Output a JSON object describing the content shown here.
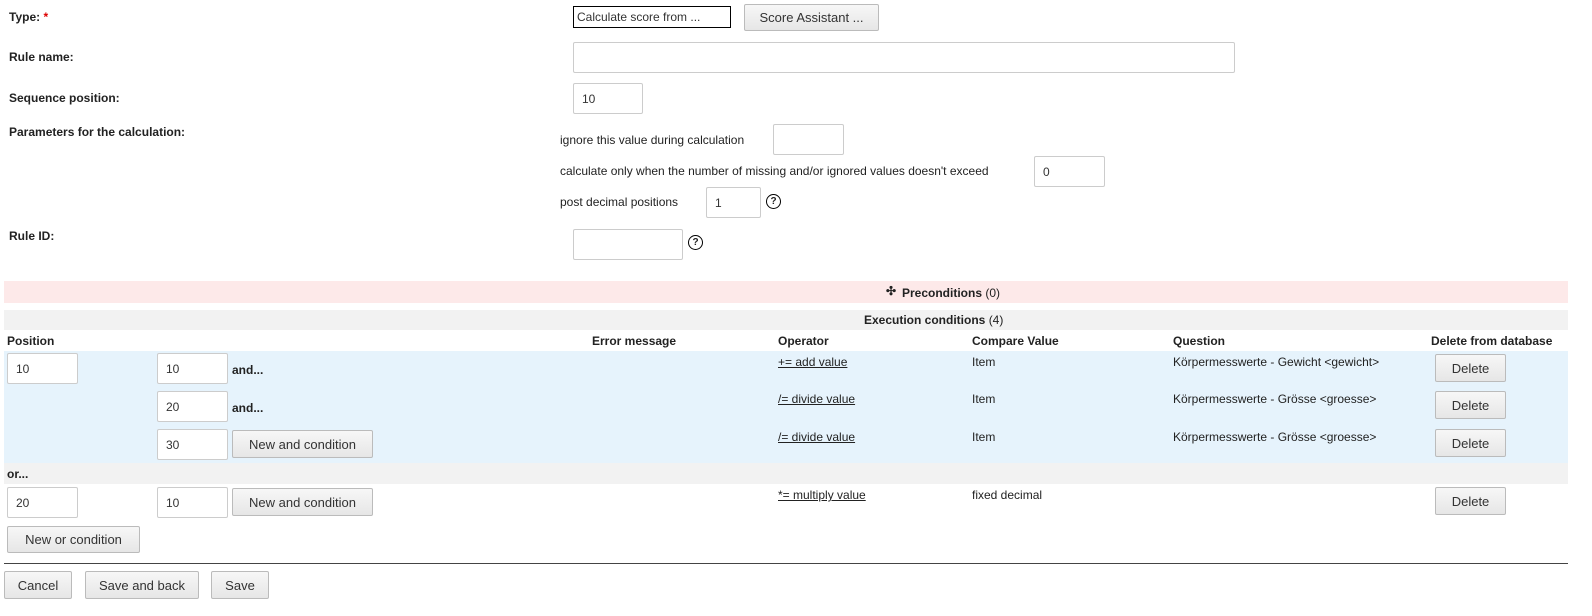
{
  "form": {
    "type_label": "Type:",
    "required_mark": "*",
    "type_value": "Calculate score from ...",
    "score_assistant": "Score Assistant ...",
    "rule_name_label": "Rule name:",
    "rule_name_value": "",
    "sequence_label": "Sequence position:",
    "sequence_value": "10",
    "params_label": "Parameters for the calculation:",
    "ignore_text": "ignore this value during calculation",
    "ignore_value": "",
    "missing_text": "calculate only when the number of missing and/or ignored values doesn't exceed",
    "missing_value": "0",
    "decimal_text": "post decimal positions",
    "decimal_value": "1",
    "rule_id_label": "Rule ID:",
    "rule_id_value": "",
    "help_glyph": "?"
  },
  "preconditions": {
    "icon": "plus-icon",
    "label": "Preconditions",
    "count": "(0)"
  },
  "execution": {
    "label": "Execution conditions",
    "count": "(4)",
    "headers": {
      "position": "Position",
      "error": "Error message",
      "operator": "Operator",
      "compare": "Compare Value",
      "question": "Question",
      "delete": "Delete from database"
    },
    "groups": [
      {
        "position": "10",
        "rows": [
          {
            "position": "10",
            "connector": "and...",
            "operator": "+= add value",
            "compare": "Item",
            "question": "Körpermesswerte - Gewicht <gewicht>",
            "delete": "Delete"
          },
          {
            "position": "20",
            "connector": "and...",
            "operator": "/= divide value",
            "compare": "Item",
            "question": "Körpermesswerte - Grösse <groesse>",
            "delete": "Delete"
          },
          {
            "position": "30",
            "connector": "New and condition",
            "operator": "/= divide value",
            "compare": "Item",
            "question": "Körpermesswerte - Grösse <groesse>",
            "delete": "Delete"
          }
        ]
      },
      {
        "position": "20",
        "rows": [
          {
            "position": "10",
            "connector": "New and condition",
            "operator": "*= multiply value",
            "compare": "fixed decimal",
            "question": "",
            "delete": "Delete"
          }
        ]
      }
    ],
    "or_label": "or...",
    "new_or": "New or condition"
  },
  "footer": {
    "cancel": "Cancel",
    "save_back": "Save and back",
    "save": "Save"
  }
}
